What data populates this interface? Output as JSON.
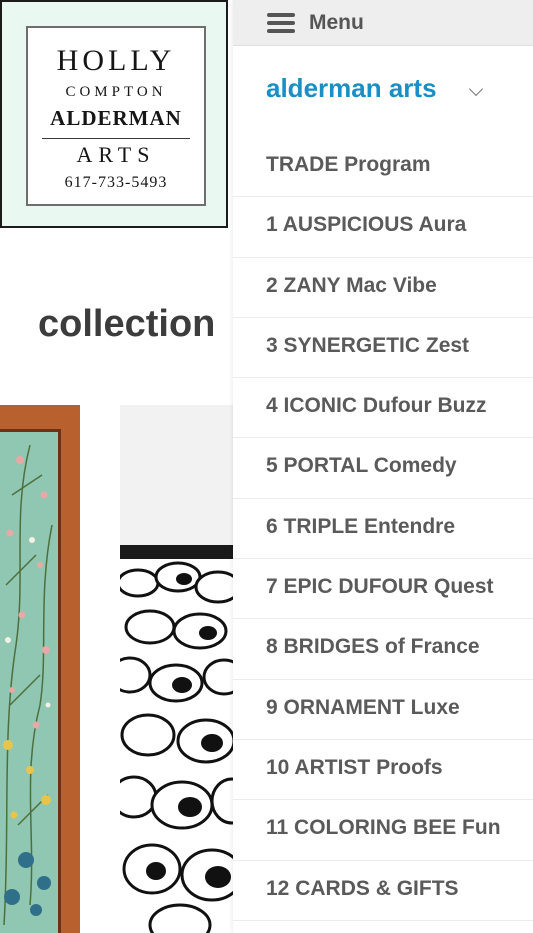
{
  "logo": {
    "line1": "HOLLY",
    "line2": "COMPTON",
    "line3": "ALDERMAN",
    "line4": "ARTS",
    "line5": "617-733-5493"
  },
  "page": {
    "title": "collection"
  },
  "menu": {
    "label": "Menu",
    "brand": "alderman arts",
    "brand_color": "#1b8fc5",
    "items": [
      "TRADE Program",
      "1 AUSPICIOUS Aura",
      "2 ZANY Mac Vibe",
      "3 SYNERGETIC Zest",
      "4 ICONIC Dufour Buzz",
      "5 PORTAL Comedy",
      "6 TRIPLE Entendre",
      "7 EPIC DUFOUR Quest",
      "8 BRIDGES of France",
      "9 ORNAMENT Luxe",
      "10 ARTIST Proofs",
      "11 COLORING BEE Fun",
      "12 CARDS & GIFTS"
    ]
  },
  "icons": {
    "menu": "hamburger-icon",
    "brand_toggle": "chevron-down-icon"
  }
}
